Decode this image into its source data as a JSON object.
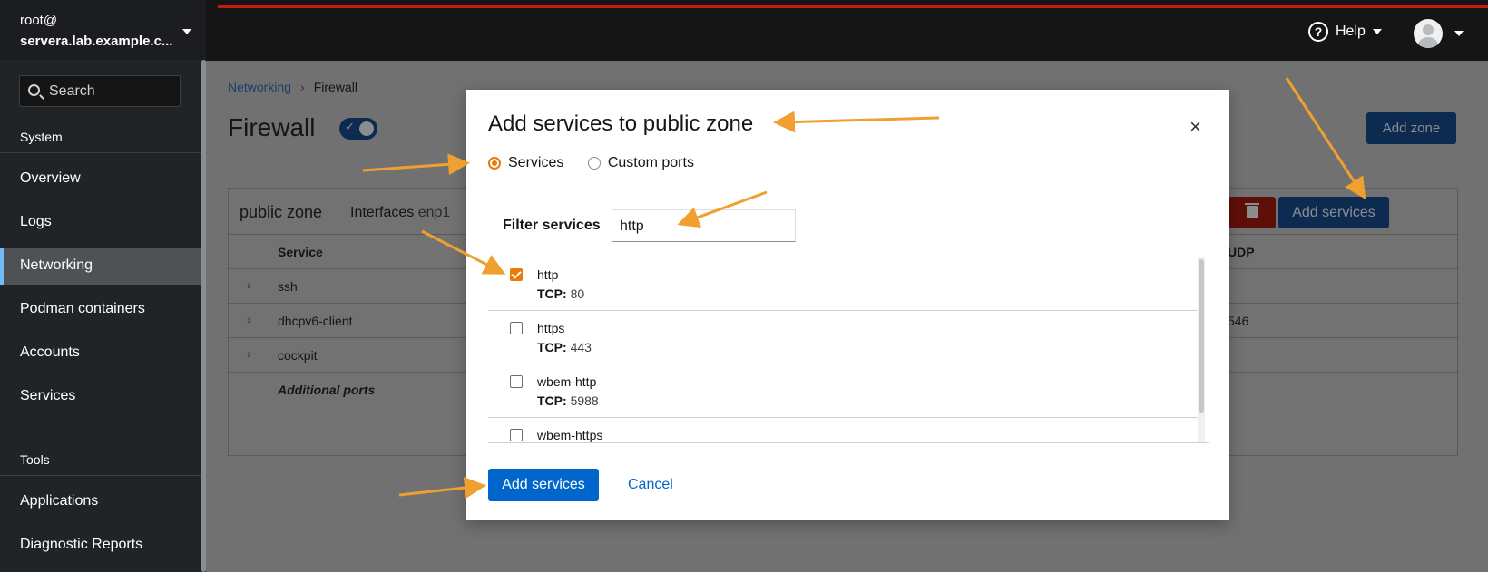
{
  "host": {
    "user": "root@",
    "machine": "servera.lab.example.c..."
  },
  "sidebar": {
    "search_placeholder": "Search",
    "system_heading": "System",
    "system_items": [
      {
        "label": "Overview"
      },
      {
        "label": "Logs"
      },
      {
        "label": "Networking",
        "active": true
      },
      {
        "label": "Podman containers"
      },
      {
        "label": "Accounts"
      },
      {
        "label": "Services"
      }
    ],
    "tools_heading": "Tools",
    "tools_items": [
      {
        "label": "Applications"
      },
      {
        "label": "Diagnostic Reports"
      }
    ]
  },
  "topbar": {
    "help_label": "Help"
  },
  "breadcrumb": {
    "parent": "Networking",
    "current": "Firewall"
  },
  "page": {
    "title": "Firewall",
    "add_zone_label": "Add zone"
  },
  "zone": {
    "name": "public zone",
    "interfaces_label": "Interfaces",
    "interfaces_value": "enp1",
    "add_services_label": "Add services",
    "columns": {
      "service": "Service",
      "udp": "UDP"
    },
    "rows": [
      {
        "service": "ssh",
        "udp": ""
      },
      {
        "service": "dhcpv6-client",
        "udp": "546"
      },
      {
        "service": "cockpit",
        "udp": ""
      }
    ],
    "additional_ports": "Additional ports"
  },
  "modal": {
    "title": "Add services to public zone",
    "close_glyph": "×",
    "radio_services": "Services",
    "radio_custom": "Custom ports",
    "filter_label": "Filter services",
    "filter_value": "http",
    "services": [
      {
        "name": "http",
        "proto": "TCP:",
        "port": "80",
        "checked": true
      },
      {
        "name": "https",
        "proto": "TCP:",
        "port": "443",
        "checked": false
      },
      {
        "name": "wbem-http",
        "proto": "TCP:",
        "port": "5988",
        "checked": false
      },
      {
        "name": "wbem-https",
        "proto": "",
        "port": "",
        "checked": false
      }
    ],
    "submit_label": "Add services",
    "cancel_label": "Cancel"
  },
  "colors": {
    "accent_orange": "#ec7a08",
    "primary_blue": "#0066cc",
    "annotation_arrow": "#f0a030"
  }
}
